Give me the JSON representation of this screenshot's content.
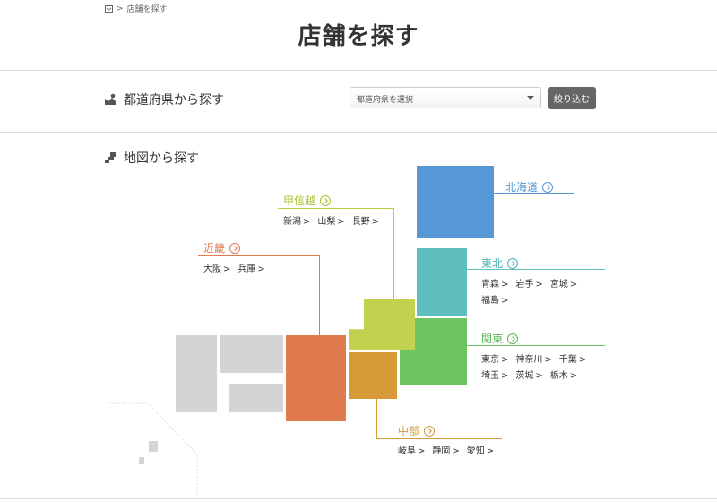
{
  "breadcrumb": {
    "current": "店舗を探す",
    "separator": ">"
  },
  "page": {
    "title": "店舗を探す"
  },
  "prefecture_search": {
    "heading": "都道府県から探す",
    "select_value": "都道府県を選択",
    "filter_button": "絞り込む"
  },
  "map_search": {
    "heading": "地図から探す"
  },
  "regions": {
    "hokkaido": {
      "name": "北海道",
      "color": "#5698d6",
      "prefectures": []
    },
    "tohoku": {
      "name": "東北",
      "color": "#5fbfbf",
      "prefectures": [
        "青森",
        "岩手",
        "宮城",
        "福島"
      ]
    },
    "kanto": {
      "name": "関東",
      "color": "#6cc462",
      "prefectures": [
        "東京",
        "神奈川",
        "千葉",
        "埼玉",
        "茨城",
        "栃木"
      ]
    },
    "koshinetsu": {
      "name": "甲信越",
      "color": "#b7cf3c",
      "prefectures": [
        "新潟",
        "山梨",
        "長野"
      ]
    },
    "chubu": {
      "name": "中部",
      "color": "#d69a39",
      "prefectures": [
        "岐阜",
        "静岡",
        "愛知"
      ]
    },
    "kinki": {
      "name": "近畿",
      "color": "#e07b4f",
      "prefectures": [
        "大阪",
        "兵庫"
      ]
    }
  }
}
